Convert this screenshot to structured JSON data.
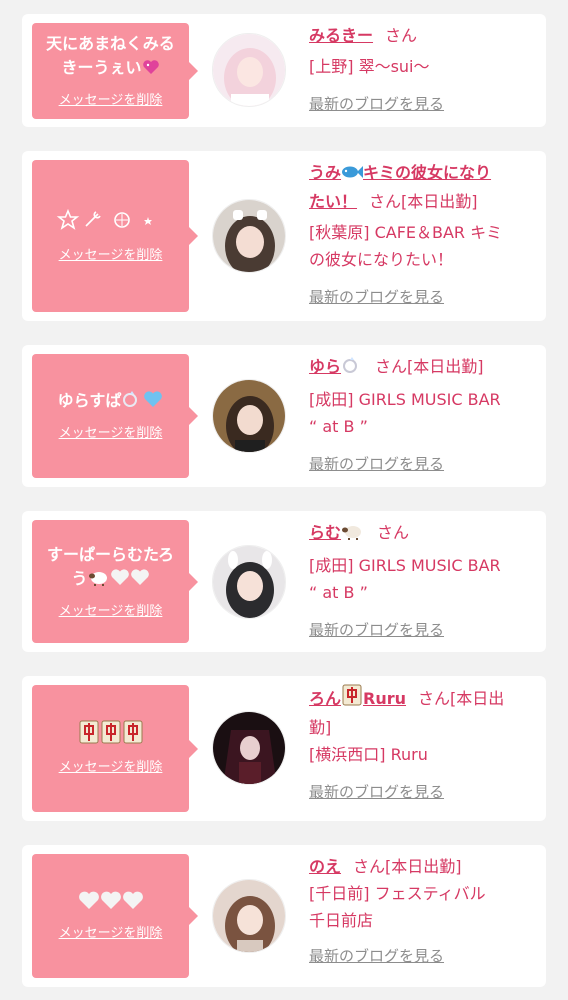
{
  "common": {
    "delete_label": "メッセージを削除",
    "blog_label": "最新のブログを見る",
    "san": "さん"
  },
  "colors": {
    "bubble": "#f8929f",
    "accent": "#d63963",
    "muted": "#8d8d8d",
    "background": "#f2f2f2"
  },
  "items": [
    {
      "message_line1": "天にあまねくみる",
      "message_line2": "きーうぇい",
      "message_emoji": "heart-sparkle",
      "name": "みるきー",
      "name_emoji": "",
      "status": "",
      "shop": "[上野] 翠〜sui〜"
    },
    {
      "message_line1": "",
      "message_line2": "",
      "message_emoji": "star-wand-decoration",
      "name_line1": "うみ",
      "name_line1_rest": "キミの彼女になり",
      "name_line2": "たい！",
      "name_emoji": "fish",
      "status": "[本日出勤]",
      "shop_line1": "[秋葉原] CAFE＆BAR キミ",
      "shop_line2": "の彼女になりたい！"
    },
    {
      "message_line1": "ゆらすぱ",
      "message_emoji": "ring-blue-heart",
      "name": "ゆら",
      "name_emoji": "ring",
      "status": "[本日出勤]",
      "shop_line1": "[成田] GIRLS MUSIC BAR",
      "shop_line2": "“ at B ”"
    },
    {
      "message_line1": "すーぱーらむたろ",
      "message_line2": "う",
      "message_emoji": "sheep-white-hearts",
      "name": "らむ",
      "name_emoji": "sheep",
      "status": "",
      "shop_line1": "[成田] GIRLS MUSIC BAR",
      "shop_line2": "“ at B ”"
    },
    {
      "message_line1": "",
      "message_emoji": "mahjong-tiles",
      "name": "ろん",
      "name_emoji": "mahjong",
      "name_suffix": "Ruru",
      "status_line1": "[本日出",
      "status_line2": "勤]",
      "shop": "[横浜西口] Ruru"
    },
    {
      "message_line1": "",
      "message_emoji": "white-hearts",
      "name": "のえ",
      "name_emoji": "",
      "status": "[本日出勤]",
      "shop_line1": "[千日前] フェスティバル",
      "shop_line2": "千日前店"
    }
  ]
}
